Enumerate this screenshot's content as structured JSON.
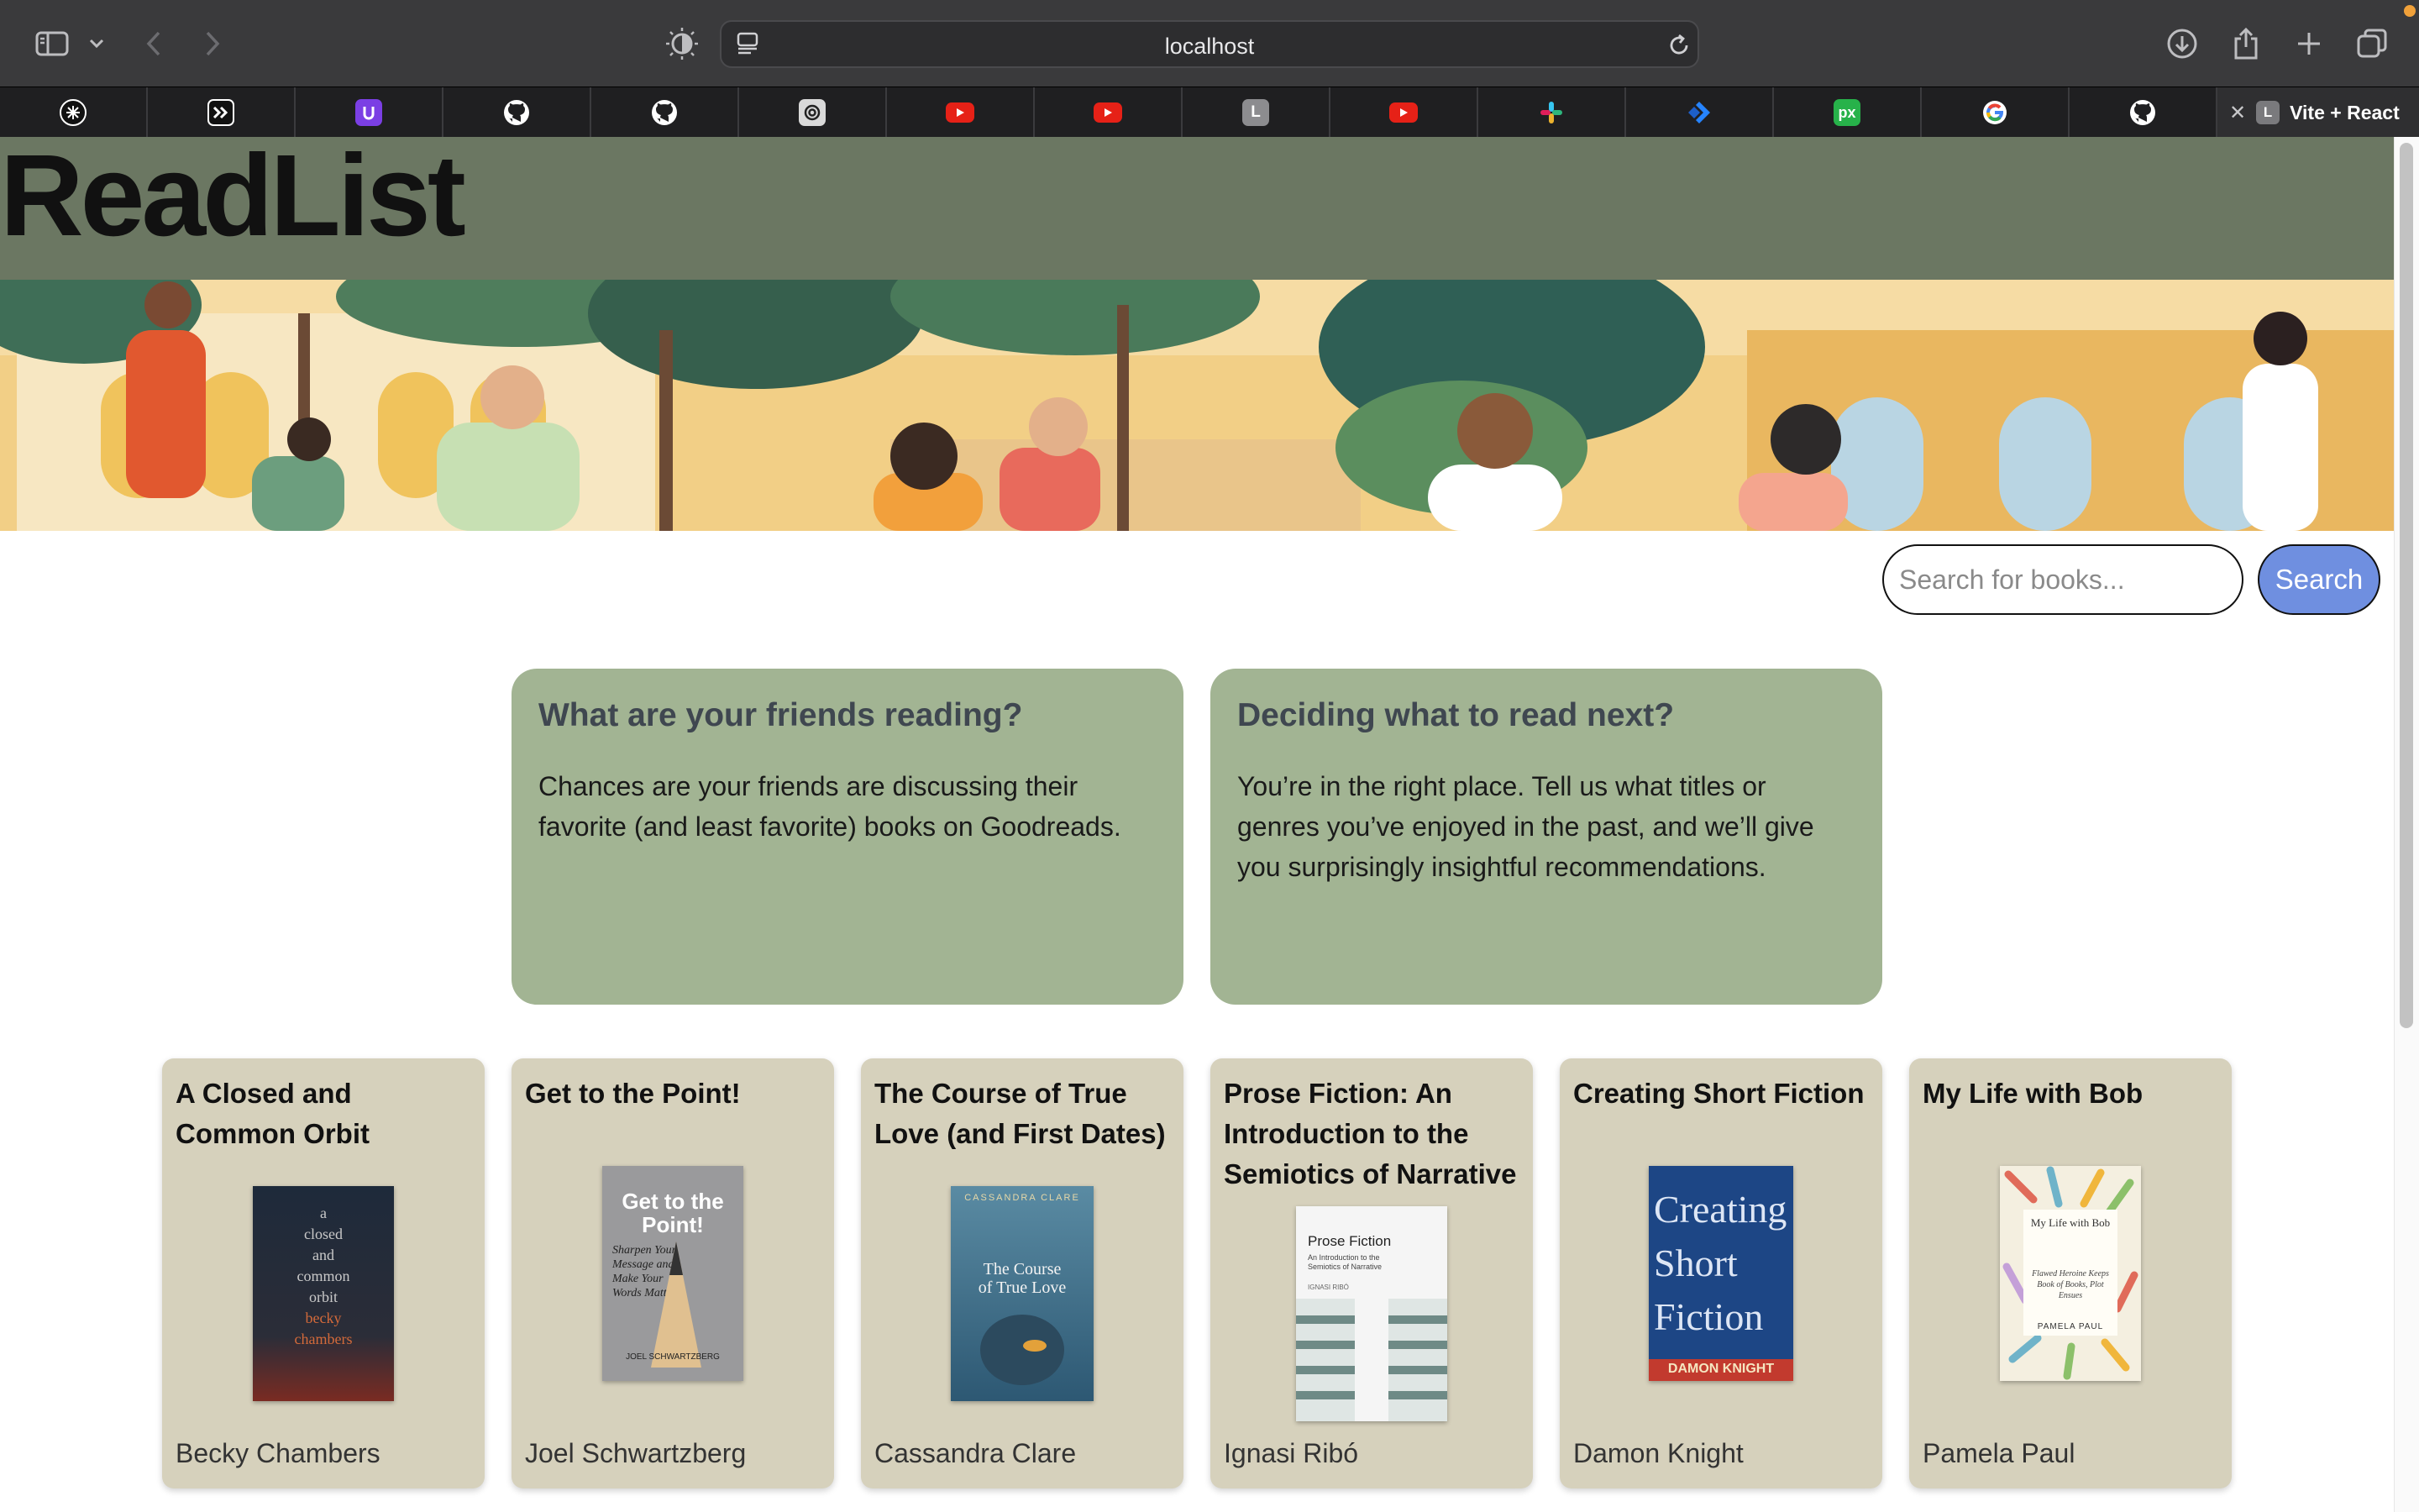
{
  "browser": {
    "url": "localhost",
    "tabs": [
      {
        "icon": "perplexity-icon"
      },
      {
        "icon": "cursor-icon"
      },
      {
        "icon": "purple-app-icon"
      },
      {
        "icon": "github-icon"
      },
      {
        "icon": "github-icon"
      },
      {
        "icon": "chatgpt-icon"
      },
      {
        "icon": "youtube-icon"
      },
      {
        "icon": "youtube-icon"
      },
      {
        "icon": "letter-l-icon",
        "letter": "L"
      },
      {
        "icon": "youtube-icon"
      },
      {
        "icon": "slack-icon"
      },
      {
        "icon": "jira-icon"
      },
      {
        "icon": "pixel-icon",
        "letter": "px"
      },
      {
        "icon": "google-icon"
      },
      {
        "icon": "github-icon"
      }
    ],
    "active_tab": {
      "title": "Vite + React",
      "letter": "L"
    }
  },
  "header": {
    "title": "ReadList"
  },
  "search": {
    "placeholder": "Search for books...",
    "button_label": "Search"
  },
  "info_cards": [
    {
      "title": "What are your friends reading?",
      "body": "Chances are your friends are discussing their favorite (and least favorite) books on Goodreads."
    },
    {
      "title": "Deciding what to read next?",
      "body": "You’re in the right place. Tell us what titles or genres you’ve enjoyed in the past, and we’ll give you surprisingly insightful recommendations."
    }
  ],
  "books": [
    {
      "title": "A Closed and Common Orbit",
      "author": "Becky Chambers",
      "cover": {
        "lines": [
          "a",
          "closed",
          "and",
          "common",
          "orbit",
          "becky",
          "chambers"
        ],
        "bg": "#1d2530"
      }
    },
    {
      "title": "Get to the Point!",
      "author": "Joel Schwartzberg",
      "cover": {
        "lines": [
          "Get to the Point!",
          "Sharpen Your Message and Make Your Words Matter",
          "JOEL SCHWARTZBERG"
        ],
        "bg": "#8f8f92"
      }
    },
    {
      "title": "The Course of True Love (and First Dates)",
      "author": "Cassandra Clare",
      "cover": {
        "lines": [
          "CASSANDRA CLARE",
          "The Course of True Love"
        ],
        "bg": "#3f6b82"
      }
    },
    {
      "title": "Prose Fiction: An Introduction to the Semiotics of Narrative",
      "author": "Ignasi Ribó",
      "cover": {
        "lines": [
          "Prose Fiction",
          "An Introduction to the Semiotics of Narrative",
          "IGNASI RIBÓ"
        ],
        "bg": "#f4f4f4"
      }
    },
    {
      "title": "Creating Short Fiction",
      "author": "Damon Knight",
      "cover": {
        "lines": [
          "Creating Short Fiction",
          "DAMON KNIGHT"
        ],
        "bg": "#1c3f7a"
      }
    },
    {
      "title": "My Life with Bob",
      "author": "Pamela Paul",
      "cover": {
        "lines": [
          "My Life with Bob",
          "Flawed Heroine Keeps Book of Books, Plot Ensues",
          "PAMELA PAUL"
        ],
        "bg": "#f3efe2"
      }
    }
  ]
}
